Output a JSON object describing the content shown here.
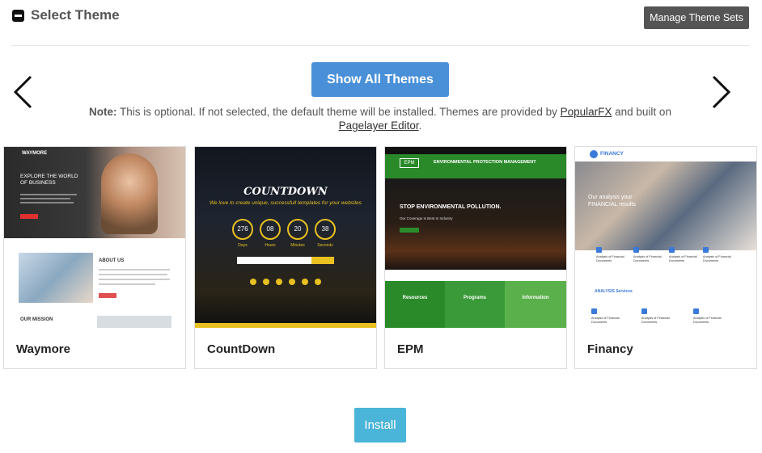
{
  "header": {
    "title": "Select Theme",
    "manage_label": "Manage Theme Sets"
  },
  "show_all_label": "Show All Themes",
  "note": {
    "label": "Note:",
    "text1": " This is optional. If not selected, the default theme will be installed. Themes are provided by ",
    "link1": "PopularFX",
    "text2": " and built on ",
    "link2": "Pagelayer Editor",
    "text3": "."
  },
  "themes": [
    {
      "name": "Waymore",
      "preview": {
        "logo": "WAYMORE",
        "headline": "EXPLORE THE WORLD OF BUSINESS",
        "about": "ABOUT US",
        "mission": "OUR MISSION"
      }
    },
    {
      "name": "CountDown",
      "preview": {
        "title": "COUNTDOWN",
        "subtitle": "We love to create unique, successfull templates for your websites",
        "counters": [
          {
            "value": "276",
            "label": "Days"
          },
          {
            "value": "08",
            "label": "Hours"
          },
          {
            "value": "20",
            "label": "Minutes"
          },
          {
            "value": "38",
            "label": "Seconds"
          }
        ]
      }
    },
    {
      "name": "EPM",
      "preview": {
        "logo": "EPM",
        "org": "ENVIRONMENTAL PROTECTION MANAGEMENT",
        "headline": "STOP ENVIRONMENTAL POLLUTION.",
        "subline": "Our Coverage Is Best In Industry",
        "columns": [
          "Resources",
          "Programs",
          "Information"
        ]
      }
    },
    {
      "name": "Financy",
      "preview": {
        "logo": "FINANCY",
        "headline": "Our analysis your FINANCIAL results",
        "section": "ANALYSIS Services",
        "item": "Analysis of Financial Documents"
      }
    }
  ],
  "install_label": "Install",
  "colors": {
    "primary": "#4a90d9",
    "install": "#4ab4d9",
    "dark_button": "#555555",
    "epm_green": "#2a8a2a",
    "countdown_yellow": "#e8c020"
  }
}
